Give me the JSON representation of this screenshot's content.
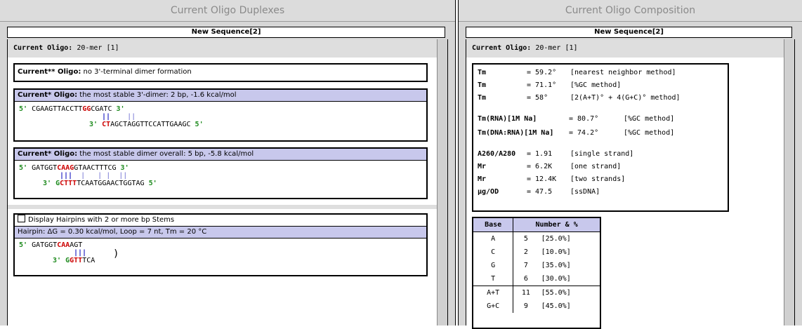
{
  "left": {
    "title": "Current Oligo Duplexes",
    "tab_label": "New Sequence[2]",
    "current_oligo_label": "Current Oligo:",
    "current_oligo_value": "20-mer [1]",
    "terminal_box": {
      "prefix": "Current** Oligo:",
      "text": "no 3'-terminal dimer formation"
    },
    "stable_3_box": {
      "prefix": "Current* Oligo:",
      "text": "the most stable 3'-dimer: 2 bp, -1.6 kcal/mol",
      "top_5": "5'",
      "top_a": "CGAAGTTACCTT",
      "top_hl": "GG",
      "top_b": "CGATC",
      "top_3": "3'",
      "bars_bold": "||",
      "bars_light": "    ||",
      "bot_3": "3'",
      "bot_hl": "CT",
      "bot_b": "AGCTAGGTTCCATTGAAGC",
      "bot_5": "5'"
    },
    "stable_overall_box": {
      "prefix": "Current* Oligo:",
      "text": "the most stable dimer overall: 5 bp, -5.8 kcal/mol",
      "top_5": "5'",
      "top_a": "GATGGT",
      "top_hl": "CAAG",
      "top_b": "GTAACTTTCG",
      "top_3": "3'",
      "bars_bold": "|||",
      "bars_light": "  |   | |  ||",
      "bot_3": "3'",
      "bot_a": "G",
      "bot_hl": "CTTT",
      "bot_b": "TCAATGGAACTGGTAG",
      "bot_5": "5'"
    },
    "hairpin_box": {
      "checkbox_label": "Display Hairpins with 2 or more bp Stems",
      "info": "Hairpin: ΔG = 0.30 kcal/mol, Loop = 7 nt, Tm = 20 °C",
      "top_5": "5'",
      "top_a": "GATGGT",
      "top_hl": "CAA",
      "top_b": "AGT",
      "bars": "|||",
      "bot_3": "3'",
      "bot_a": "G",
      "bot_hl": "GTT",
      "bot_b": "TCA",
      "loop": ")"
    }
  },
  "right": {
    "title": "Current Oligo Composition",
    "tab_label": "New Sequence[2]",
    "current_oligo_label": "Current Oligo:",
    "current_oligo_value": "20-mer [1]",
    "props": [
      {
        "label": "Tm",
        "eq": "= 59.2°",
        "note": "[nearest neighbor method]"
      },
      {
        "label": "Tm",
        "eq": "= 71.1°",
        "note": "[%GC method]"
      },
      {
        "label": "Tm",
        "eq": "= 58°",
        "note": "[2(A+T)° + 4(G+C)° method]"
      },
      {
        "label": "Tm(RNA)[1M Na]",
        "eq": "= 80.7°",
        "note": "[%GC method]"
      },
      {
        "label": "Tm(DNA:RNA)[1M Na]",
        "eq": "= 74.2°",
        "note": "[%GC method]"
      },
      {
        "label": "A260/A280",
        "eq": "= 1.91",
        "note": "[single strand]"
      },
      {
        "label": "Mr",
        "eq": "= 6.2K",
        "note": "[one strand]"
      },
      {
        "label": "Mr",
        "eq": "= 12.4K",
        "note": "[two strands]"
      },
      {
        "label": "µg/OD",
        "eq": "= 47.5",
        "note": "[ssDNA]"
      }
    ],
    "composition": {
      "headers": [
        "Base",
        "Number & %"
      ],
      "rows": [
        {
          "base": "A",
          "num": "5",
          "pct": "[25.0%]"
        },
        {
          "base": "C",
          "num": "2",
          "pct": "[10.0%]"
        },
        {
          "base": "G",
          "num": "7",
          "pct": "[35.0%]"
        },
        {
          "base": "T",
          "num": "6",
          "pct": "[30.0%]"
        }
      ],
      "summary": [
        {
          "base": "A+T",
          "num": "11",
          "pct": "[55.0%]"
        },
        {
          "base": "G+C",
          "num": "9",
          "pct": "[45.0%]"
        }
      ]
    }
  }
}
